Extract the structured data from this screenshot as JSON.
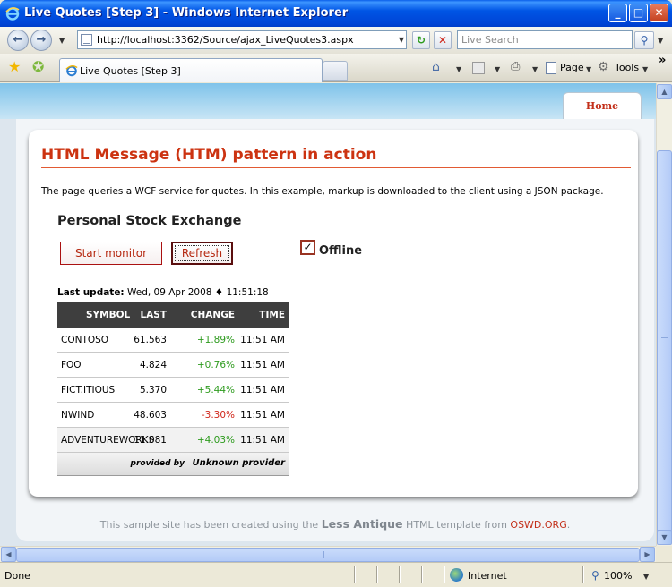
{
  "window": {
    "title": "Live Quotes [Step 3] - Windows Internet Explorer",
    "min_glyph": "_",
    "max_glyph": "□",
    "close_glyph": "✕"
  },
  "address_bar": {
    "url": "http://localhost:3362/Source/ajax_LiveQuotes3.aspx",
    "search_placeholder": "Live Search"
  },
  "tab": {
    "label": "Live Quotes [Step 3]"
  },
  "command_bar": {
    "page_label": "Page",
    "tools_label": "Tools",
    "more_glyph": "»"
  },
  "site": {
    "nav_home": "Home",
    "heading": "HTML Message (HTM) pattern in action",
    "description": "The page queries a WCF service for quotes. In this example, markup is downloaded to the client using a JSON package.",
    "widget_title": "Personal Stock Exchange",
    "start_button": "Start monitor",
    "refresh_button": "Refresh",
    "offline_label": "Offline",
    "offline_checked": true,
    "last_update_label": "Last update:",
    "last_update_value": "Wed, 09 Apr 2008 ♦ 11:51:18",
    "table": {
      "headers": [
        "SYMBOL",
        "LAST",
        "CHANGE",
        "TIME"
      ],
      "rows": [
        {
          "symbol": "CONTOSO",
          "last": "61.563",
          "change": "+1.89%",
          "time": "11:51 AM",
          "trend": "up"
        },
        {
          "symbol": "FOO",
          "last": "4.824",
          "change": "+0.76%",
          "time": "11:51 AM",
          "trend": "up"
        },
        {
          "symbol": "FICT.ITIOUS",
          "last": "5.370",
          "change": "+5.44%",
          "time": "11:51 AM",
          "trend": "up"
        },
        {
          "symbol": "NWIND",
          "last": "48.603",
          "change": "-3.30%",
          "time": "11:51 AM",
          "trend": "down"
        },
        {
          "symbol": "ADVENTUREWORKS",
          "last": "11.081",
          "change": "+4.03%",
          "time": "11:51 AM",
          "trend": "up"
        }
      ],
      "provided_by_label": "provided by",
      "provider_name": "Unknown provider"
    },
    "footer": {
      "prefix": "This sample site has been created using the",
      "template_name": "Less Antique",
      "middle": "HTML template from",
      "org": "OSWD.ORG",
      "suffix": "."
    }
  },
  "status_bar": {
    "status": "Done",
    "zone": "Internet",
    "zoom": "100%"
  },
  "colors": {
    "accent": "#CC3311",
    "positive": "#2E9B1E",
    "negative": "#D0261A"
  }
}
